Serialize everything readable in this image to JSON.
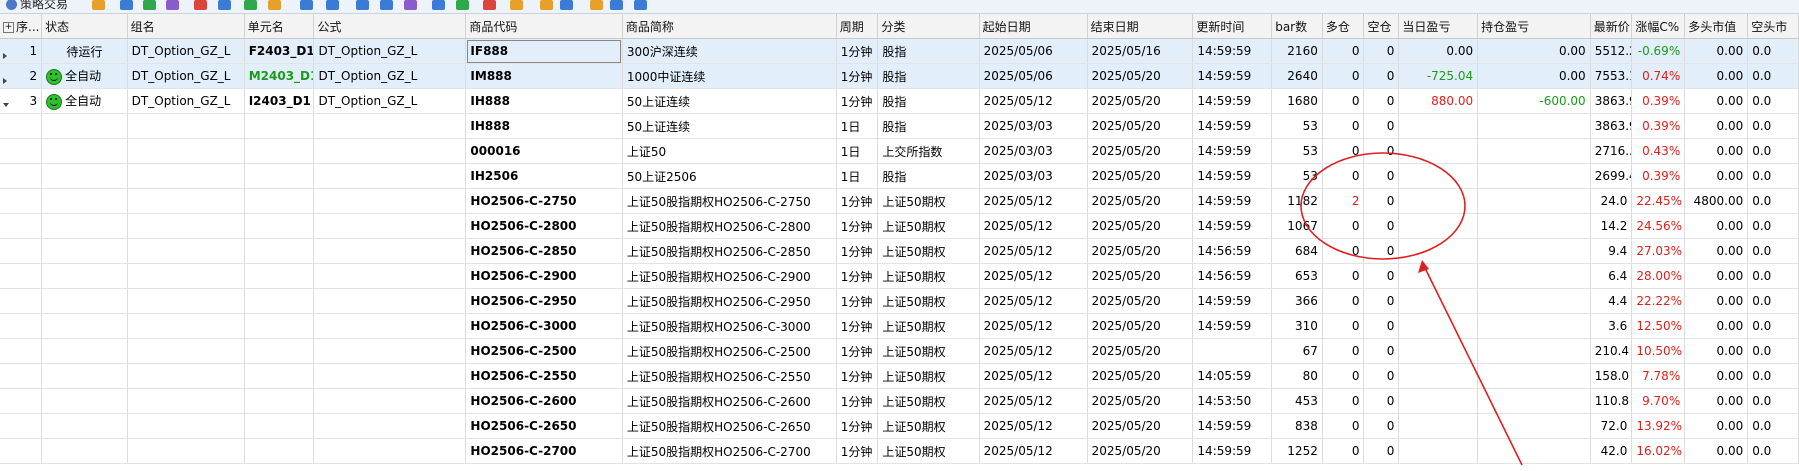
{
  "toolbar": {
    "title": "策略交易",
    "icons": [
      "orange-icon",
      "blue-icon",
      "green-icon",
      "purple-icon",
      "red-icon",
      "blue-icon",
      "green-icon",
      "orange-icon",
      "blue-icon",
      "blue-icon",
      "blue-icon",
      "blue-icon",
      "purple-icon",
      "blue-icon",
      "green-icon",
      "red-icon",
      "orange-icon",
      "orange-icon",
      "blue-icon",
      "orange-icon",
      "blue-icon",
      "blue-icon"
    ]
  },
  "columns": [
    "序...",
    "状态",
    "组名",
    "单元名",
    "公式",
    "商品代码",
    "商品简称",
    "周期",
    "分类",
    "起始日期",
    "结束日期",
    "更新时间",
    "bar数",
    "多仓",
    "空仓",
    "当日盈亏",
    "持仓盈亏",
    "最新价",
    "涨幅C%",
    "多头市值",
    "空头市"
  ],
  "rows": [
    {
      "idx": "1",
      "status": "待运行",
      "smile": false,
      "group": "DT_Option_GZ_L",
      "unit": "F2403_D1",
      "unit_num": "19",
      "unit_color": "black",
      "formula": "DT_Option_GZ_L",
      "code": "IF888",
      "name": "300沪深连续",
      "period": "1分钟",
      "cat": "股指",
      "start": "2025/05/06",
      "end": "2025/05/16",
      "update": "14:59:59",
      "bars": "2160",
      "long": "0",
      "short": "0",
      "day_pl": "0.00",
      "day_pl_color": "black",
      "pos_pl": "0.00",
      "pos_pl_color": "black",
      "last": "5512.2",
      "chg": "-0.69%",
      "chg_color": "green",
      "long_val": "0.00",
      "short_val": "0.0",
      "selected": true,
      "expand": "right"
    },
    {
      "idx": "2",
      "status": "全自动",
      "smile": true,
      "group": "DT_Option_GZ_L",
      "unit": "M2403_D1",
      "unit_num": "9",
      "unit_color": "green",
      "formula": "DT_Option_GZ_L",
      "code": "IM888",
      "name": "1000中证连续",
      "period": "1分钟",
      "cat": "股指",
      "start": "2025/05/06",
      "end": "2025/05/20",
      "update": "14:59:59",
      "bars": "2640",
      "long": "0",
      "short": "0",
      "day_pl": "-725.04",
      "day_pl_color": "green",
      "pos_pl": "0.00",
      "pos_pl_color": "black",
      "last": "7553.1",
      "chg": "0.74%",
      "chg_color": "red",
      "long_val": "0.00",
      "short_val": "0.0",
      "selected": true,
      "expand": "right"
    },
    {
      "idx": "3",
      "status": "全自动",
      "smile": true,
      "group": "DT_Option_GZ_L",
      "unit": "I2403_D1",
      "unit_num": "15",
      "unit_color": "black",
      "formula": "DT_Option_GZ_L",
      "code": "IH888",
      "name": "50上证连续",
      "period": "1分钟",
      "cat": "股指",
      "start": "2025/05/12",
      "end": "2025/05/20",
      "update": "14:59:59",
      "bars": "1680",
      "long": "0",
      "short": "0",
      "day_pl": "880.00",
      "day_pl_color": "red",
      "pos_pl": "-600.00",
      "pos_pl_color": "green",
      "last": "3863.9",
      "chg": "0.39%",
      "chg_color": "red",
      "long_val": "0.00",
      "short_val": "0.0",
      "selected": false,
      "expand": "down"
    },
    {
      "idx": "",
      "status": "",
      "smile": false,
      "group": "",
      "unit": "",
      "unit_num": "",
      "unit_color": "black",
      "formula": "",
      "code": "IH888",
      "name": "50上证连续",
      "period": "1日",
      "cat": "股指",
      "start": "2025/03/03",
      "end": "2025/05/20",
      "update": "14:59:59",
      "bars": "53",
      "long": "0",
      "short": "0",
      "day_pl": "",
      "day_pl_color": "black",
      "pos_pl": "",
      "pos_pl_color": "black",
      "last": "3863.9",
      "chg": "0.39%",
      "chg_color": "red",
      "long_val": "0.00",
      "short_val": "0.0",
      "selected": false,
      "expand": ""
    },
    {
      "idx": "",
      "status": "",
      "smile": false,
      "group": "",
      "unit": "",
      "unit_num": "",
      "unit_color": "black",
      "formula": "",
      "code": "000016",
      "name": "上证50",
      "period": "1日",
      "cat": "上交所指数",
      "start": "2025/03/03",
      "end": "2025/05/20",
      "update": "14:59:59",
      "bars": "53",
      "long": "0",
      "short": "0",
      "day_pl": "",
      "day_pl_color": "black",
      "pos_pl": "",
      "pos_pl_color": "black",
      "last": "2716...",
      "chg": "0.43%",
      "chg_color": "red",
      "long_val": "0.00",
      "short_val": "0.0",
      "selected": false,
      "expand": ""
    },
    {
      "idx": "",
      "status": "",
      "smile": false,
      "group": "",
      "unit": "",
      "unit_num": "",
      "unit_color": "black",
      "formula": "",
      "code": "IH2506",
      "name": "50上证2506",
      "period": "1日",
      "cat": "股指",
      "start": "2025/03/03",
      "end": "2025/05/20",
      "update": "14:59:59",
      "bars": "53",
      "long": "0",
      "short": "0",
      "day_pl": "",
      "day_pl_color": "black",
      "pos_pl": "",
      "pos_pl_color": "black",
      "last": "2699.4",
      "chg": "0.39%",
      "chg_color": "red",
      "long_val": "0.00",
      "short_val": "0.0",
      "selected": false,
      "expand": ""
    },
    {
      "idx": "",
      "status": "",
      "smile": false,
      "group": "",
      "unit": "",
      "unit_num": "",
      "unit_color": "black",
      "formula": "",
      "code": "HO2506-C-2750",
      "name": "上证50股指期权HO2506-C-2750",
      "period": "1分钟",
      "cat": "上证50期权",
      "start": "2025/05/12",
      "end": "2025/05/20",
      "update": "14:59:59",
      "bars": "1182",
      "long": "2",
      "long_red": true,
      "short": "0",
      "day_pl": "",
      "day_pl_color": "black",
      "pos_pl": "",
      "pos_pl_color": "black",
      "last": "24.0",
      "chg": "22.45%",
      "chg_color": "red",
      "long_val": "4800.00",
      "short_val": "0.0",
      "selected": false,
      "expand": ""
    },
    {
      "idx": "",
      "status": "",
      "smile": false,
      "group": "",
      "unit": "",
      "unit_num": "",
      "unit_color": "black",
      "formula": "",
      "code": "HO2506-C-2800",
      "name": "上证50股指期权HO2506-C-2800",
      "period": "1分钟",
      "cat": "上证50期权",
      "start": "2025/05/12",
      "end": "2025/05/20",
      "update": "14:59:59",
      "bars": "1067",
      "long": "0",
      "short": "0",
      "day_pl": "",
      "day_pl_color": "black",
      "pos_pl": "",
      "pos_pl_color": "black",
      "last": "14.2",
      "chg": "24.56%",
      "chg_color": "red",
      "long_val": "0.00",
      "short_val": "0.0",
      "selected": false,
      "expand": ""
    },
    {
      "idx": "",
      "status": "",
      "smile": false,
      "group": "",
      "unit": "",
      "unit_num": "",
      "unit_color": "black",
      "formula": "",
      "code": "HO2506-C-2850",
      "name": "上证50股指期权HO2506-C-2850",
      "period": "1分钟",
      "cat": "上证50期权",
      "start": "2025/05/12",
      "end": "2025/05/20",
      "update": "14:56:59",
      "bars": "684",
      "long": "0",
      "short": "0",
      "day_pl": "",
      "day_pl_color": "black",
      "pos_pl": "",
      "pos_pl_color": "black",
      "last": "9.4",
      "chg": "27.03%",
      "chg_color": "red",
      "long_val": "0.00",
      "short_val": "0.0",
      "selected": false,
      "expand": ""
    },
    {
      "idx": "",
      "status": "",
      "smile": false,
      "group": "",
      "unit": "",
      "unit_num": "",
      "unit_color": "black",
      "formula": "",
      "code": "HO2506-C-2900",
      "name": "上证50股指期权HO2506-C-2900",
      "period": "1分钟",
      "cat": "上证50期权",
      "start": "2025/05/12",
      "end": "2025/05/20",
      "update": "14:56:59",
      "bars": "653",
      "long": "0",
      "short": "0",
      "day_pl": "",
      "day_pl_color": "black",
      "pos_pl": "",
      "pos_pl_color": "black",
      "last": "6.4",
      "chg": "28.00%",
      "chg_color": "red",
      "long_val": "0.00",
      "short_val": "0.0",
      "selected": false,
      "expand": ""
    },
    {
      "idx": "",
      "status": "",
      "smile": false,
      "group": "",
      "unit": "",
      "unit_num": "",
      "unit_color": "black",
      "formula": "",
      "code": "HO2506-C-2950",
      "name": "上证50股指期权HO2506-C-2950",
      "period": "1分钟",
      "cat": "上证50期权",
      "start": "2025/05/12",
      "end": "2025/05/20",
      "update": "14:59:59",
      "bars": "366",
      "long": "0",
      "short": "0",
      "day_pl": "",
      "day_pl_color": "black",
      "pos_pl": "",
      "pos_pl_color": "black",
      "last": "4.4",
      "chg": "22.22%",
      "chg_color": "red",
      "long_val": "0.00",
      "short_val": "0.0",
      "selected": false,
      "expand": ""
    },
    {
      "idx": "",
      "status": "",
      "smile": false,
      "group": "",
      "unit": "",
      "unit_num": "",
      "unit_color": "black",
      "formula": "",
      "code": "HO2506-C-3000",
      "name": "上证50股指期权HO2506-C-3000",
      "period": "1分钟",
      "cat": "上证50期权",
      "start": "2025/05/12",
      "end": "2025/05/20",
      "update": "14:59:59",
      "bars": "310",
      "long": "0",
      "short": "0",
      "day_pl": "",
      "day_pl_color": "black",
      "pos_pl": "",
      "pos_pl_color": "black",
      "last": "3.6",
      "chg": "12.50%",
      "chg_color": "red",
      "long_val": "0.00",
      "short_val": "0.0",
      "selected": false,
      "expand": ""
    },
    {
      "idx": "",
      "status": "",
      "smile": false,
      "group": "",
      "unit": "",
      "unit_num": "",
      "unit_color": "black",
      "formula": "",
      "code": "HO2506-C-2500",
      "name": "上证50股指期权HO2506-C-2500",
      "period": "1分钟",
      "cat": "上证50期权",
      "start": "2025/05/12",
      "end": "2025/05/20",
      "update": "",
      "bars": "67",
      "long": "0",
      "short": "0",
      "day_pl": "",
      "day_pl_color": "black",
      "pos_pl": "",
      "pos_pl_color": "black",
      "last": "210.4",
      "chg": "10.50%",
      "chg_color": "red",
      "long_val": "0.00",
      "short_val": "0.0",
      "selected": false,
      "expand": ""
    },
    {
      "idx": "",
      "status": "",
      "smile": false,
      "group": "",
      "unit": "",
      "unit_num": "",
      "unit_color": "black",
      "formula": "",
      "code": "HO2506-C-2550",
      "name": "上证50股指期权HO2506-C-2550",
      "period": "1分钟",
      "cat": "上证50期权",
      "start": "2025/05/12",
      "end": "2025/05/20",
      "update": "14:05:59",
      "bars": "80",
      "long": "0",
      "short": "0",
      "day_pl": "",
      "day_pl_color": "black",
      "pos_pl": "",
      "pos_pl_color": "black",
      "last": "158.0",
      "chg": "7.78%",
      "chg_color": "red",
      "long_val": "0.00",
      "short_val": "0.0",
      "selected": false,
      "expand": ""
    },
    {
      "idx": "",
      "status": "",
      "smile": false,
      "group": "",
      "unit": "",
      "unit_num": "",
      "unit_color": "black",
      "formula": "",
      "code": "HO2506-C-2600",
      "name": "上证50股指期权HO2506-C-2600",
      "period": "1分钟",
      "cat": "上证50期权",
      "start": "2025/05/12",
      "end": "2025/05/20",
      "update": "14:53:50",
      "bars": "453",
      "long": "0",
      "short": "0",
      "day_pl": "",
      "day_pl_color": "black",
      "pos_pl": "",
      "pos_pl_color": "black",
      "last": "110.8",
      "chg": "9.70%",
      "chg_color": "red",
      "long_val": "0.00",
      "short_val": "0.0",
      "selected": false,
      "expand": ""
    },
    {
      "idx": "",
      "status": "",
      "smile": false,
      "group": "",
      "unit": "",
      "unit_num": "",
      "unit_color": "black",
      "formula": "",
      "code": "HO2506-C-2650",
      "name": "上证50股指期权HO2506-C-2650",
      "period": "1分钟",
      "cat": "上证50期权",
      "start": "2025/05/12",
      "end": "2025/05/20",
      "update": "14:59:59",
      "bars": "838",
      "long": "0",
      "short": "0",
      "day_pl": "",
      "day_pl_color": "black",
      "pos_pl": "",
      "pos_pl_color": "black",
      "last": "72.0",
      "chg": "13.92%",
      "chg_color": "red",
      "long_val": "0.00",
      "short_val": "0.0",
      "selected": false,
      "expand": ""
    },
    {
      "idx": "",
      "status": "",
      "smile": false,
      "group": "",
      "unit": "",
      "unit_num": "",
      "unit_color": "black",
      "formula": "",
      "code": "HO2506-C-2700",
      "name": "上证50股指期权HO2506-C-2700",
      "period": "1分钟",
      "cat": "上证50期权",
      "start": "2025/05/12",
      "end": "2025/05/20",
      "update": "14:59:59",
      "bars": "1252",
      "long": "0",
      "short": "0",
      "day_pl": "",
      "day_pl_color": "black",
      "pos_pl": "",
      "pos_pl_color": "black",
      "last": "42.0",
      "chg": "16.02%",
      "chg_color": "red",
      "long_val": "0.00",
      "short_val": "0.0",
      "selected": false,
      "expand": ""
    }
  ],
  "annotation": {
    "color": "#e02020",
    "shapes": [
      "ellipse",
      "arrow"
    ]
  },
  "colors": {
    "selected_row": "#e2eef9",
    "header_bg": "#f3f3f3",
    "red": "#e0201c",
    "green": "#1a9b1a"
  }
}
